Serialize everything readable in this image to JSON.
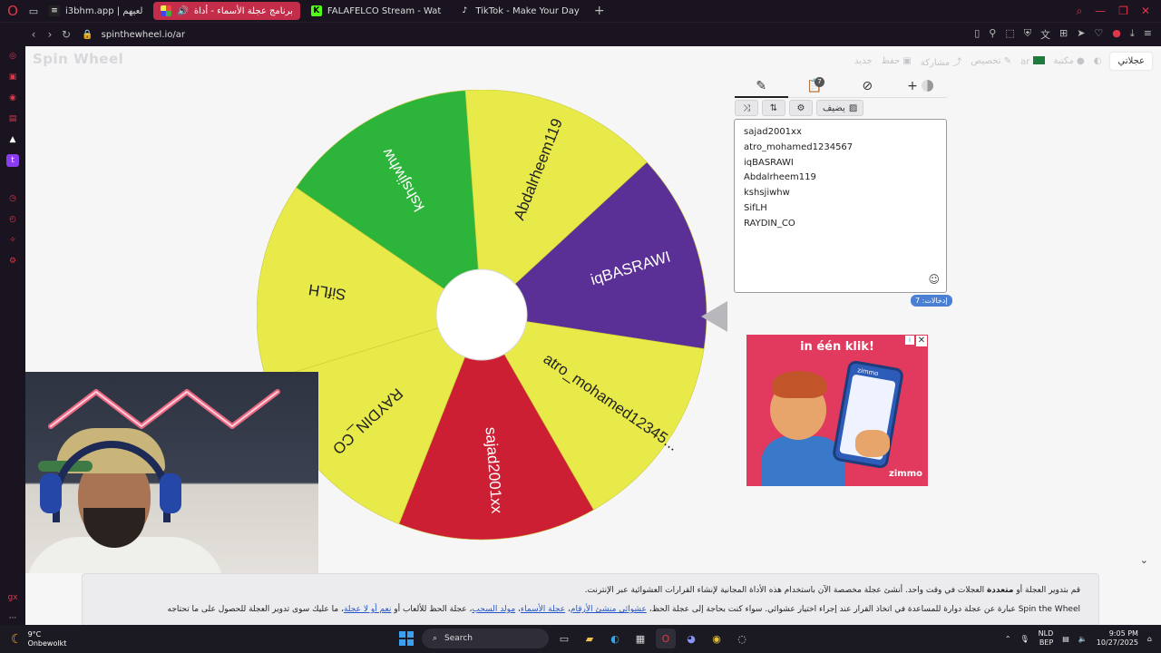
{
  "browser": {
    "tabs": [
      {
        "label": "i3bhm.app | لعيهم",
        "active": false
      },
      {
        "label": "برنامج عجلة الأسماء - أداة",
        "active": true
      },
      {
        "label": "FALAFELCO Stream - Wat",
        "active": false
      },
      {
        "label": "TikTok - Make Your Day",
        "active": false
      }
    ],
    "url": "spinthewheel.io/ar"
  },
  "site": {
    "logo": "Spin Wheel",
    "menu": {
      "my_wheels": "عجلاتي",
      "gallery": "مكتبة",
      "lang": "ar",
      "customize": "تخصيص",
      "share": "مشاركة",
      "save": "حفظ",
      "new": "جديد"
    }
  },
  "wheel": {
    "segments": [
      {
        "label": "iqBASRAWI",
        "color": "#5a2f96"
      },
      {
        "label": "atro_mohamed12345...",
        "color": "#e8ea49"
      },
      {
        "label": "sajad2001xx",
        "color": "#cc1f33"
      },
      {
        "label": "RAYDIN_CO",
        "color": "#e8ea49"
      },
      {
        "label": "SifLH",
        "color": "#e8ea49"
      },
      {
        "label": "kshsjiwhw",
        "color": "#2db43a"
      },
      {
        "label": "Abdalrheem119",
        "color": "#e8ea49"
      }
    ]
  },
  "panel": {
    "tools": {
      "add_image": "يضيف"
    },
    "entries": [
      "sajad2001xx",
      "atro_mohamed1234567",
      "iqBASRAWI",
      "Abdalrheem119",
      "kshsjiwhw",
      "SifLH",
      "RAYDIN_CO"
    ],
    "entries_count": "إدخالات: 7",
    "badge_count": "7"
  },
  "ad": {
    "headline": "in één klik!",
    "brand": "zimmo",
    "phone_brand": "zimmo"
  },
  "description": {
    "line1_a": "قم بتدوير العجلة أو ",
    "line1_bold": "متعددة",
    "line1_b": " العجلات في وقت واحد. أنشئ عجلة مخصصة الآن باستخدام هذه الأداة المجانية لإنشاء القرارات العشوائية عبر الإنترنت.",
    "line2_a": "Spin the Wheel عبارة عن عجلة دوارة للمساعدة في اتخاذ القرار عند إجراء اختيار عشوائي. سواء كنت بحاجة إلى عجلة الحظ، ",
    "link1": "عشوائي منشئ الأرقام",
    "sep1": "، ",
    "link2": "عجلة الأسماء",
    "sep2": "، ",
    "link3": "مولد السحب",
    "line2_b": "، عجلة الحظ للألعاب أو ",
    "link4": "نعم أو لا عجلة",
    "line2_c": "، ما عليك سوى تدوير العجلة للحصول على ما تحتاجه"
  },
  "taskbar": {
    "weather_temp": "9°C",
    "weather_desc": "Onbewolkt",
    "search": "Search",
    "lang1": "NLD",
    "lang2": "BEP",
    "time": "9:05 PM",
    "date": "10/27/2025"
  },
  "colors": {
    "browser_accent": "#c42d4a",
    "wheel_yellow": "#e8ea49",
    "wheel_purple": "#5a2f96",
    "wheel_red": "#cc1f33",
    "wheel_green": "#2db43a"
  }
}
